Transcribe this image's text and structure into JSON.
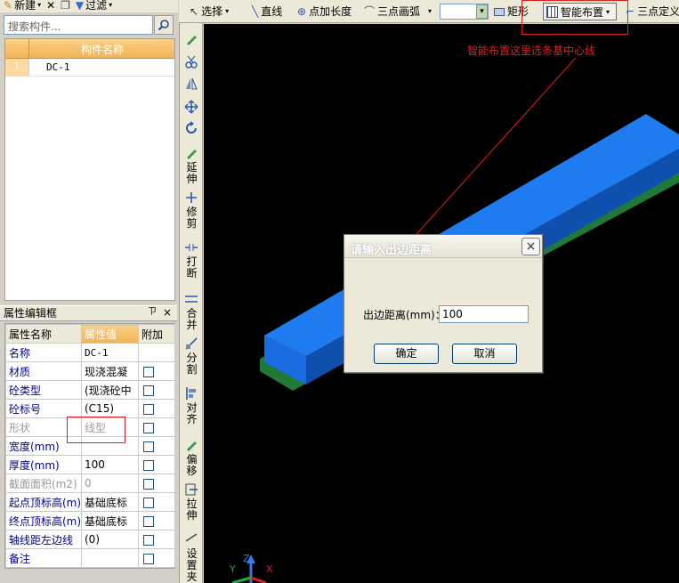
{
  "left_toolbar": {
    "new_label": "新建",
    "filter_label": "过滤"
  },
  "search": {
    "placeholder": "搜索构件..."
  },
  "component_list": {
    "header": "构件名称",
    "rows": [
      {
        "index": "1",
        "name": "DC-1"
      }
    ]
  },
  "property_panel": {
    "title": "属性编辑框",
    "pin": "ㄗ",
    "close": "×",
    "col_name": "属性名称",
    "col_value": "属性值",
    "col_attach": "附加",
    "rows": [
      {
        "name": "名称",
        "value": "DC-1"
      },
      {
        "name": "材质",
        "value": "现浇混凝"
      },
      {
        "name": "砼类型",
        "value": "(现浇砼中"
      },
      {
        "name": "砼标号",
        "value": "(C15)"
      },
      {
        "name": "形状",
        "value": "线型"
      },
      {
        "name": "宽度(mm)",
        "value": ""
      },
      {
        "name": "厚度(mm)",
        "value": "100"
      },
      {
        "name": "截面面积(m2)",
        "value": "0"
      },
      {
        "name": "起点顶标高(m)",
        "value": "基础底标"
      },
      {
        "name": "终点顶标高(m)",
        "value": "基础底标"
      },
      {
        "name": "轴线距左边线",
        "value": "(0)"
      },
      {
        "name": "备注",
        "value": ""
      }
    ]
  },
  "main_toolbar": {
    "select": "选择",
    "line": "直线",
    "point_length": "点加长度",
    "three_point_arc": "三点画弧",
    "rect": "矩形",
    "smart_layout": "智能布置",
    "three_point_define": "三点定义"
  },
  "vertical_tools": {
    "extend": "延伸",
    "trim": "修剪",
    "break": "打断",
    "merge": "合并",
    "split": "分割",
    "align": "对齐",
    "offset": "偏移",
    "stretch": "拉伸",
    "set_clamp": "设置夹"
  },
  "annotation": {
    "text": "智能布置这里选条基中心线"
  },
  "dialog": {
    "title": "请输入出边距离",
    "close": "×",
    "label": "出边距离(mm)：",
    "value": "100",
    "ok": "确定",
    "cancel": "取消"
  },
  "axes": {
    "x": "X",
    "y": "Y",
    "z": "Z"
  },
  "colors": {
    "beam_top": "#1f7cf0",
    "beam_side": "#0f4fae",
    "beam_base": "#1f7a3a",
    "annotation": "#e02020"
  }
}
